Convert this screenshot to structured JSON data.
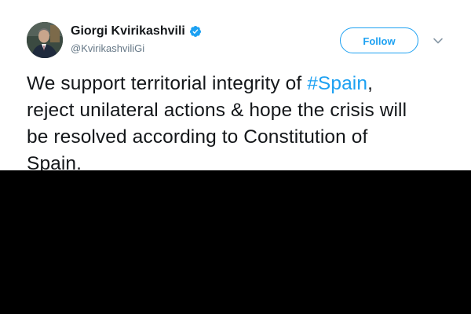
{
  "author": {
    "name": "Giorgi Kvirikashvili",
    "handle": "@KvirikashviliGi",
    "verified_icon": "verified-badge-icon",
    "avatar_icon": "profile-photo"
  },
  "actions": {
    "follow_label": "Follow",
    "more_icon": "chevron-down-icon"
  },
  "tweet": {
    "line1_before": "We support territorial integrity of ",
    "line1_hashtag": "#Spain",
    "line1_after": ",",
    "line2": "reject unilateral actions & hope the crisis will",
    "line3": "be resolved according to Constitution of",
    "line4": "Spain."
  },
  "colors": {
    "accent": "#1da1f2",
    "text": "#14171a",
    "secondary_text": "#657786",
    "background_below": "#000000"
  }
}
